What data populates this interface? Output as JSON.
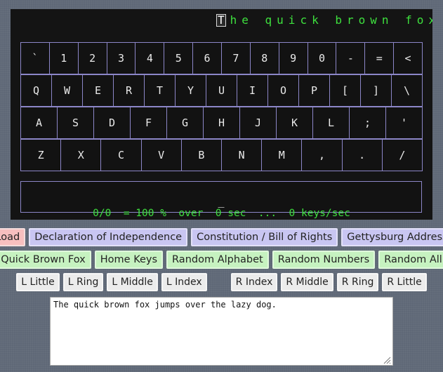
{
  "ticker": {
    "cursor_char": "T",
    "text": "he quick brown fox jumps"
  },
  "keyboard": {
    "row1": [
      "`",
      "1",
      "2",
      "3",
      "4",
      "5",
      "6",
      "7",
      "8",
      "9",
      "0",
      "-",
      "=",
      "<"
    ],
    "row2": [
      "Q",
      "W",
      "E",
      "R",
      "T",
      "Y",
      "U",
      "I",
      "O",
      "P",
      "[",
      "]",
      "\\"
    ],
    "row3": [
      "A",
      "S",
      "D",
      "F",
      "G",
      "H",
      "J",
      "K",
      "L",
      ";",
      "'"
    ],
    "row4": [
      "Z",
      "X",
      "C",
      "V",
      "B",
      "N",
      "M",
      ",",
      ".",
      "/"
    ],
    "space": "_"
  },
  "stats": "0/0  = 100 %  over  0 sec  ...  0 keys/sec",
  "buttons": {
    "row1": [
      "Load",
      "Declaration of Independence",
      "Constitution / Bill of Rights",
      "Gettysburg Address"
    ],
    "row2": [
      "Quick Brown Fox",
      "Home Keys",
      "Random Alphabet",
      "Random Numbers",
      "Random All"
    ],
    "row3_left": [
      "L Little",
      "L Ring",
      "L Middle",
      "L Index"
    ],
    "row3_right": [
      "R Index",
      "R Middle",
      "R Ring",
      "R Little"
    ]
  },
  "textarea": {
    "value": "The quick brown fox jumps over the lazy dog."
  }
}
